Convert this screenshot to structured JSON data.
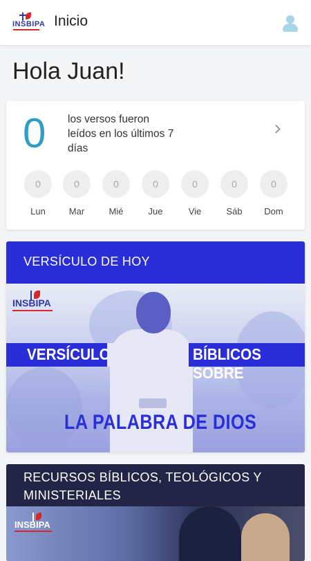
{
  "header": {
    "logo_text": "INSBIPA",
    "title": "Inicio",
    "avatar_icon": "user-avatar-icon"
  },
  "greeting": "Hola Juan!",
  "stats": {
    "count": "0",
    "description": "los versos fueron leídos en los últimos 7 días",
    "days": [
      {
        "label": "Lun",
        "value": "0"
      },
      {
        "label": "Mar",
        "value": "0"
      },
      {
        "label": "Mié",
        "value": "0"
      },
      {
        "label": "Jue",
        "value": "0"
      },
      {
        "label": "Vie",
        "value": "0"
      },
      {
        "label": "Sáb",
        "value": "0"
      },
      {
        "label": "Dom",
        "value": "0"
      }
    ],
    "accent_color": "#2e9ec4"
  },
  "verse_of_day": {
    "header": "VERSÍCULO DE HOY",
    "image_logo": "INSBIPA",
    "banner_left": "VERSÍCULOS",
    "banner_right": "BÍBLICOS SOBRE",
    "headline": "LA PALABRA DE DIOS",
    "color": "#2a2ed9"
  },
  "resources": {
    "header": "RECURSOS BÍBLICOS, TEOLÓGICOS Y MINISTERIALES",
    "image_logo": "INSBIPA",
    "color": "#232547"
  }
}
